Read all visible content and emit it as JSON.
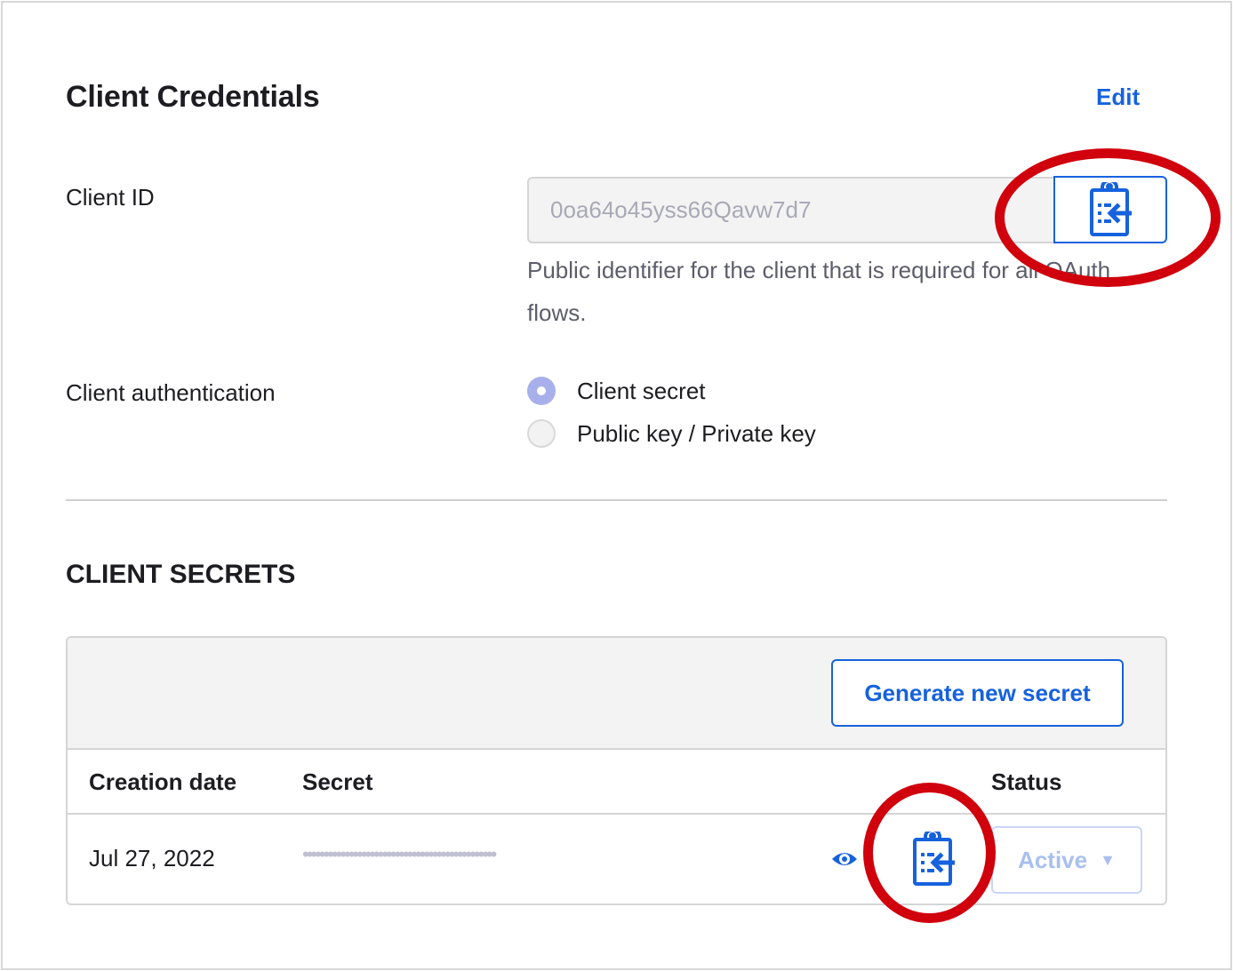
{
  "header": {
    "title": "Client Credentials",
    "edit_label": "Edit"
  },
  "client_id": {
    "label": "Client ID",
    "value": "0oa64o45yss66Qavw7d7",
    "copy_icon": "clipboard-copy-icon",
    "hint": "Public identifier for the client that is required for all OAuth flows."
  },
  "client_auth": {
    "label": "Client authentication",
    "options": [
      {
        "label": "Client secret",
        "selected": true
      },
      {
        "label": "Public key / Private key",
        "selected": false
      }
    ]
  },
  "secrets": {
    "title": "CLIENT SECRETS",
    "generate_label": "Generate new secret",
    "columns": [
      "Creation date",
      "Secret",
      "Status"
    ],
    "rows": [
      {
        "creation_date": "Jul 27, 2022",
        "secret_masked": "••••••••••••••••••••••••••••••••••••••••••••••",
        "status": "Active",
        "status_arrow": "▼"
      }
    ]
  },
  "colors": {
    "accent": "#1662dd",
    "annotation": "#d0000d",
    "radio_selected": "#a7b0ea"
  }
}
